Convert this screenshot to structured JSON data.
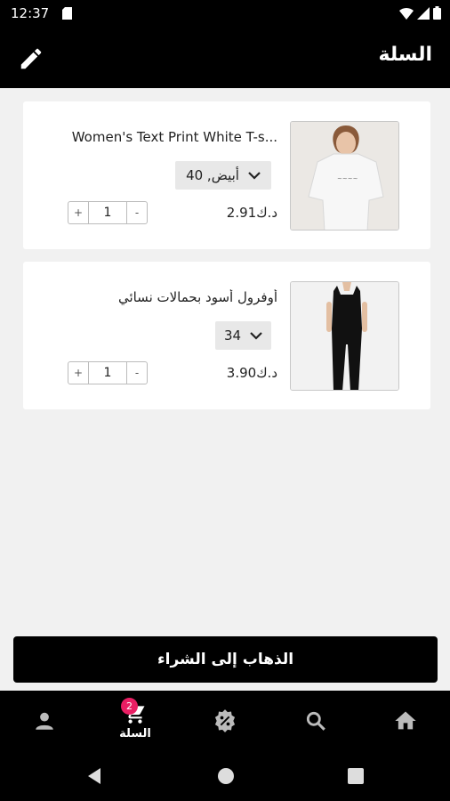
{
  "status_bar": {
    "time": "12:37"
  },
  "app_bar": {
    "title": "السلة"
  },
  "cart": {
    "items": [
      {
        "title": "Women's Text Print White T-s...",
        "variant": "أبيض, 40",
        "price": "د.ك2.91",
        "quantity": "1",
        "plus": "+",
        "minus": "-"
      },
      {
        "title": "أوفرول أسود بحمالات نسائي",
        "variant": "34",
        "price": "د.ك3.90",
        "quantity": "1",
        "plus": "+",
        "minus": "-"
      }
    ]
  },
  "checkout": {
    "label": "الذهاب إلى الشراء"
  },
  "bottom_nav": {
    "cart_label": "السلة",
    "cart_badge": "2",
    "items": [
      "profile-icon",
      "cart-icon",
      "discount-icon",
      "search-icon",
      "home-icon"
    ]
  },
  "colors": {
    "background": "#f1f1f1",
    "bar": "#000000",
    "badge": "#e91e63"
  }
}
